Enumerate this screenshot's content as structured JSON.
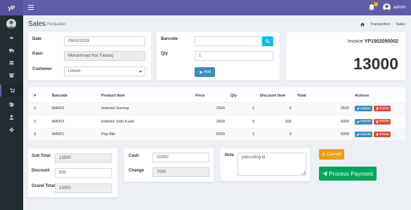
{
  "header": {
    "logo": "yP",
    "notification_count": "4",
    "user_name": "admin"
  },
  "page": {
    "title": "Sales",
    "subtitle": "Penjualan",
    "breadcrumb": [
      "Transaction",
      "Sales"
    ]
  },
  "form": {
    "date_label": "Date",
    "date_value": "09/02/2019",
    "cashier_label": "Kasir",
    "cashier_value": "Mohammad Nur Fawaiq",
    "customer_label": "Customer",
    "customer_value": "Umum",
    "barcode_label": "Barcode",
    "barcode_value": "",
    "qty_label": "Qty",
    "qty_value": "1",
    "add_label": "Add"
  },
  "invoice": {
    "label": "Invoice",
    "number": "YP1902090002",
    "grand_total": "13000"
  },
  "cart": {
    "columns": [
      "#",
      "Barcode",
      "Product Item",
      "Price",
      "Qty",
      "Discount Item",
      "Total",
      "Actions"
    ],
    "update_label": "Update",
    "delete_label": "Delete",
    "rows": [
      {
        "no": "1.",
        "barcode": "MA002",
        "product": "Indomie Goreng",
        "price": "2500",
        "qty": "1",
        "discount": "0",
        "total": "2500"
      },
      {
        "no": "2.",
        "barcode": "MA003",
        "product": "Indomie Soto Kuah",
        "price": "2500",
        "qty": "3",
        "discount": "500",
        "total": "6000"
      },
      {
        "no": "3.",
        "barcode": "MA001",
        "product": "Pop Mie",
        "price": "5000",
        "qty": "1",
        "discount": "0",
        "total": "5000"
      }
    ]
  },
  "summary": {
    "subtotal_label": "Sub Total",
    "subtotal_value": "13500",
    "discount_label": "Discount",
    "discount_value": "500",
    "grand_total_label": "Grand Total",
    "grand_total_value": "13000",
    "cash_label": "Cash",
    "cash_value": "20000",
    "change_label": "Change",
    "change_value": "7000",
    "note_label": "Note",
    "note_value": "yukcoding.id"
  },
  "actions": {
    "cancel_label": "Cancel",
    "process_label": "Process Payment"
  },
  "colors": {
    "topbar": "#605ca8",
    "sidebar": "#222d32",
    "primary": "#3c8dbc",
    "danger": "#dd4b39",
    "warning": "#f39c12",
    "success": "#00a65a"
  }
}
